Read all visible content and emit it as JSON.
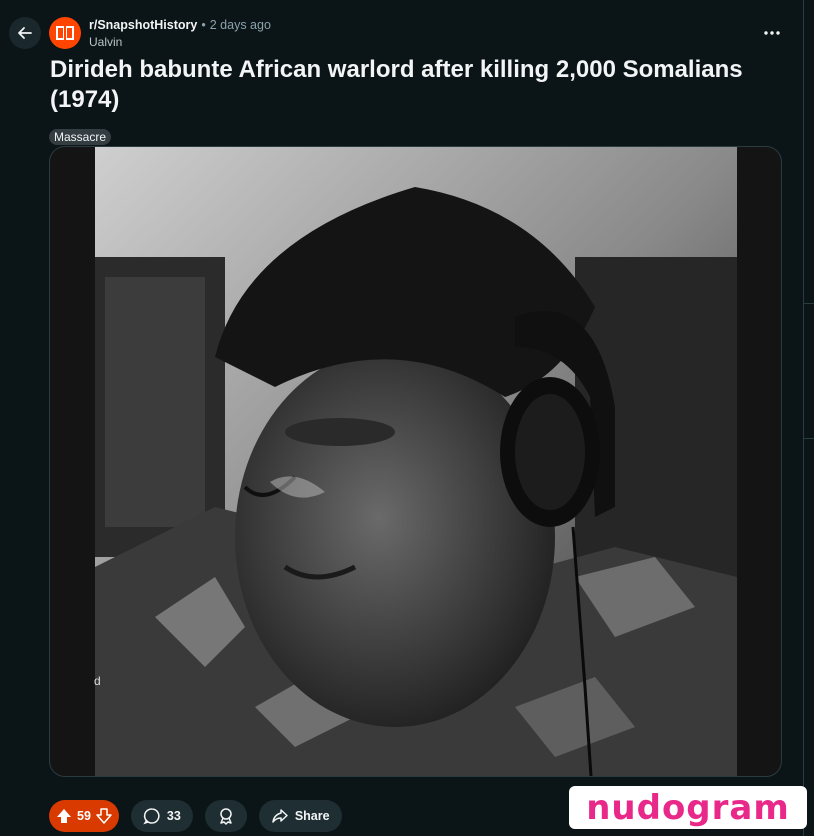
{
  "post": {
    "subreddit": "r/SnapshotHistory",
    "separator": "•",
    "time_ago": "2 days ago",
    "author": "Ualvin",
    "title": "Dirideh babunte African warlord after killing 2,000 Somalians (1974)",
    "flair": "Massacre"
  },
  "media": {
    "side_text": "d",
    "description_hint": "grayscale photo"
  },
  "actions": {
    "upvotes": "59",
    "comments": "33",
    "share_label": "Share"
  },
  "watermark": {
    "text": "nudogram"
  },
  "icons": {
    "back": "back-arrow-icon",
    "subreddit": "book-icon",
    "more": "overflow-dots-icon",
    "upvote": "upvote-arrow-icon",
    "downvote": "downvote-arrow-icon",
    "comment": "comment-bubble-icon",
    "award": "award-icon",
    "share": "share-arrow-icon"
  },
  "colors": {
    "background": "#0b1416",
    "accent": "#ff4500",
    "upvote_active": "#d93a00",
    "watermark": "#e8298a"
  }
}
